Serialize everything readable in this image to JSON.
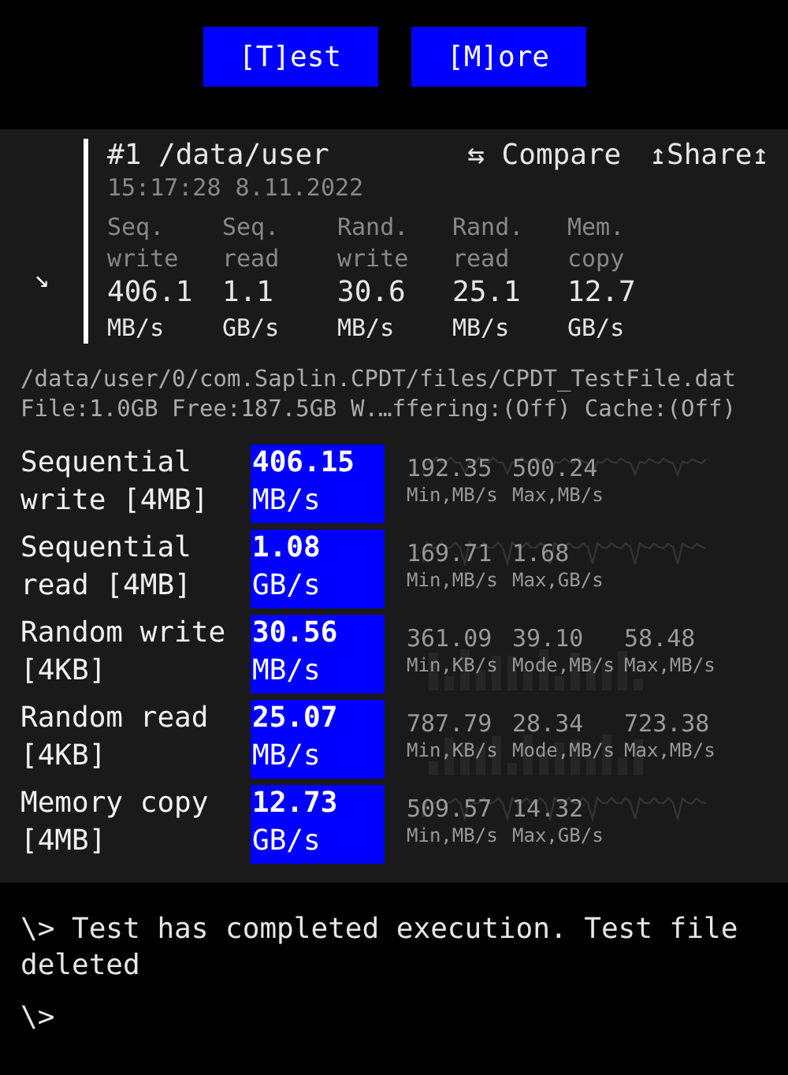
{
  "buttons": [
    {
      "label": "[T]est"
    },
    {
      "label": "[M]ore"
    }
  ],
  "result": {
    "expand_icon": "↘",
    "title": "#1 /data/user",
    "compare": "⇆ Compare",
    "share": "↥Share↥",
    "timestamp": "15:17:28 8.11.2022",
    "summary": [
      {
        "label": "Seq. write",
        "value": "406.1",
        "unit": "MB/s"
      },
      {
        "label": "Seq. read",
        "value": "1.1",
        "unit": "GB/s"
      },
      {
        "label": "Rand. write",
        "value": "30.6",
        "unit": "MB/s"
      },
      {
        "label": "Rand. read",
        "value": "25.1",
        "unit": "MB/s"
      },
      {
        "label": "Mem. copy",
        "value": "12.7",
        "unit": "GB/s"
      }
    ]
  },
  "file_path": "/data/user/0/com.Saplin.CPDT/files/CPDT_TestFile.dat",
  "file_info": "File:1.0GB Free:187.5GB W.…ffering:(Off) Cache:(Off)",
  "tests": [
    {
      "name": "Sequential write [4MB]",
      "value": "406.15",
      "unit": "MB/s",
      "kind": "line",
      "stats": [
        {
          "value": "192.35",
          "label": "Min,MB/s"
        },
        {
          "value": "500.24",
          "label": "Max,MB/s"
        }
      ]
    },
    {
      "name": "Sequential read [4MB]",
      "value": "1.08",
      "unit": "GB/s",
      "kind": "line",
      "stats": [
        {
          "value": "169.71",
          "label": "Min,MB/s"
        },
        {
          "value": "1.68",
          "label": "Max,GB/s"
        }
      ]
    },
    {
      "name": "Random write [4KB]",
      "value": "30.56",
      "unit": "MB/s",
      "kind": "histogram",
      "stats": [
        {
          "value": "361.09",
          "label": "Min,KB/s"
        },
        {
          "value": "39.10",
          "label": "Mode,MB/s"
        },
        {
          "value": "58.48",
          "label": "Max,MB/s"
        }
      ]
    },
    {
      "name": "Random read [4KB]",
      "value": "25.07",
      "unit": "MB/s",
      "kind": "histogram",
      "stats": [
        {
          "value": "787.79",
          "label": "Min,KB/s"
        },
        {
          "value": "28.34",
          "label": "Mode,MB/s"
        },
        {
          "value": "723.38",
          "label": "Max,MB/s"
        }
      ]
    },
    {
      "name": "Memory copy [4MB]",
      "value": "12.73",
      "unit": "GB/s",
      "kind": "line",
      "stats": [
        {
          "value": "509.57",
          "label": "Min,MB/s"
        },
        {
          "value": "14.32",
          "label": "Max,GB/s"
        }
      ]
    }
  ],
  "console": [
    "\\> Test has completed execution. Test file deleted",
    "\\>"
  ]
}
